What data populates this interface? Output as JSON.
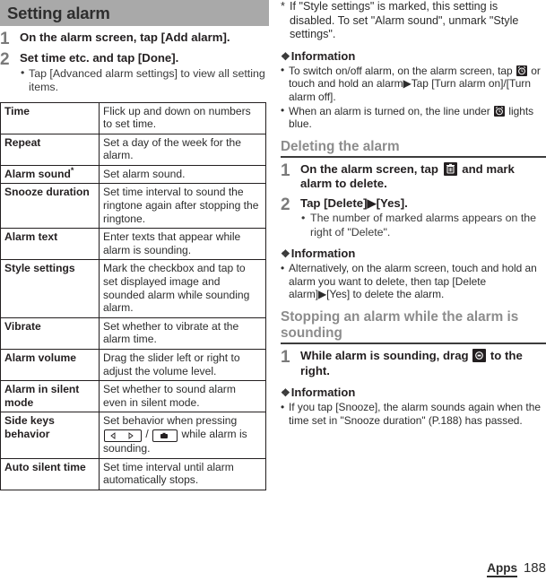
{
  "header": {
    "title": "Setting alarm"
  },
  "left": {
    "steps": [
      {
        "num": "1",
        "headline": "On the alarm screen, tap [Add alarm].",
        "bullets": []
      },
      {
        "num": "2",
        "headline": "Set time etc. and tap [Done].",
        "bullets": [
          "Tap [Advanced alarm settings] to view all setting items."
        ]
      }
    ],
    "table": {
      "rows": [
        {
          "key": "Time",
          "key_asterisk": false,
          "value": "Flick up and down on numbers to set time."
        },
        {
          "key": "Repeat",
          "key_asterisk": false,
          "value": "Set a day of the week for the alarm."
        },
        {
          "key": "Alarm sound",
          "key_asterisk": true,
          "value": "Set alarm sound."
        },
        {
          "key": "Snooze duration",
          "key_asterisk": false,
          "value": "Set time interval to sound the ringtone again after stopping the ringtone."
        },
        {
          "key": "Alarm text",
          "key_asterisk": false,
          "value": "Enter texts that appear while alarm is sounding."
        },
        {
          "key": "Style settings",
          "key_asterisk": false,
          "value": "Mark the checkbox and tap to set displayed image and sounded alarm while sounding alarm."
        },
        {
          "key": "Vibrate",
          "key_asterisk": false,
          "value": "Set whether to vibrate at the alarm time."
        },
        {
          "key": "Alarm volume",
          "key_asterisk": false,
          "value": "Drag the slider left or right to adjust the volume level."
        },
        {
          "key": "Alarm in silent mode",
          "key_asterisk": false,
          "value": "Set whether to sound alarm even in silent mode."
        },
        {
          "key": "Side keys behavior",
          "key_asterisk": false,
          "value_pre": "Set behavior when pressing ",
          "value_mid": " / ",
          "value_post": " while alarm is sounding.",
          "has_keys": true
        },
        {
          "key": "Auto silent time",
          "key_asterisk": false,
          "value": "Set time interval until alarm automatically stops."
        }
      ]
    }
  },
  "right": {
    "footnote": {
      "mark": "*",
      "text": "If \"Style settings\" is marked, this setting is disabled. To set \"Alarm sound\", unmark \"Style settings\"."
    },
    "info1": {
      "heading": "Information",
      "items": [
        {
          "pre": "To switch on/off alarm, on the alarm screen, tap ",
          "post": " or touch and hold an alarm▶Tap [Turn alarm on]/[Turn alarm off].",
          "icon": "alarm-clock-icon"
        },
        {
          "pre": "When an alarm is turned on, the line under ",
          "post": " lights blue.",
          "icon": "alarm-clock-icon"
        }
      ]
    },
    "section2": {
      "heading": "Deleting the alarm",
      "steps": [
        {
          "num": "1",
          "headline_pre": "On the alarm screen, tap ",
          "headline_post": " and mark alarm to delete.",
          "icon": "trash-icon",
          "bullets": []
        },
        {
          "num": "2",
          "headline": "Tap [Delete]▶[Yes].",
          "bullets": [
            "The number of marked alarms appears on the right of \"Delete\"."
          ]
        }
      ],
      "info": {
        "heading": "Information",
        "items": [
          {
            "text": "Alternatively, on the alarm screen, touch and hold an alarm you want to delete, then tap [Delete alarm]▶[Yes] to delete the alarm."
          }
        ]
      }
    },
    "section3": {
      "heading": "Stopping an alarm while the alarm is sounding",
      "steps": [
        {
          "num": "1",
          "headline_pre": "While alarm is sounding, drag ",
          "headline_post": " to the right.",
          "icon": "drag-alarm-icon",
          "bullets": []
        }
      ],
      "info": {
        "heading": "Information",
        "items": [
          {
            "text": "If you tap [Snooze], the alarm sounds again when the time set in \"Snooze duration\" (P.188) has passed."
          }
        ]
      }
    }
  },
  "footer": {
    "tab": "Apps",
    "page": "188"
  },
  "colors": {
    "header_bar": "#a9a9a9",
    "heading_text": "#8c8c8c",
    "body_text": "#231f20",
    "rule": "#3c3c3c"
  }
}
